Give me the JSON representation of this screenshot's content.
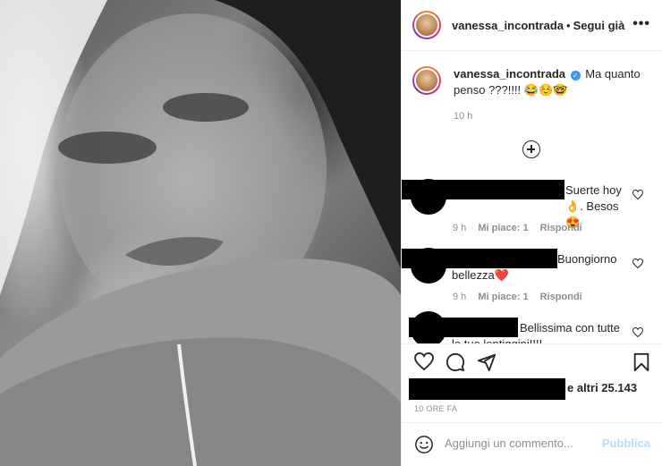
{
  "post": {
    "username": "vanessa_incontrada",
    "dot": "•",
    "follow_label": "Segui già",
    "more_label": "•••"
  },
  "caption": {
    "username": "vanessa_incontrada",
    "text": "Ma quanto penso ???!!!! 😂☺️🤓",
    "time": "10 h"
  },
  "comments": [
    {
      "text": "Suerte hoy👌. Besos😍",
      "time": "9 h",
      "likes": "Mi piace: 1",
      "reply": "Rispondi"
    },
    {
      "text": "Buongiorno bellezza❤️",
      "time": "9 h",
      "likes": "Mi piace: 1",
      "reply": "Rispondi"
    },
    {
      "text": "Bellissima con tutte le tue lentiggini!!!!",
      "time": "",
      "likes": "",
      "reply": ""
    }
  ],
  "likes": {
    "text": "e altri 25.143"
  },
  "posted_time": "10 ORE FA",
  "add_comment": {
    "placeholder": "Aggiungi un commento...",
    "publish_label": "Pubblica"
  },
  "colors": {
    "link_blue": "#3897f0",
    "publish_disabled": "#b2dffc",
    "muted": "#8e8e8e",
    "text": "#262626"
  },
  "icons": [
    "heart-icon",
    "comment-icon",
    "share-icon",
    "bookmark-icon",
    "smile-icon",
    "plus-circle-icon",
    "verified-icon"
  ]
}
